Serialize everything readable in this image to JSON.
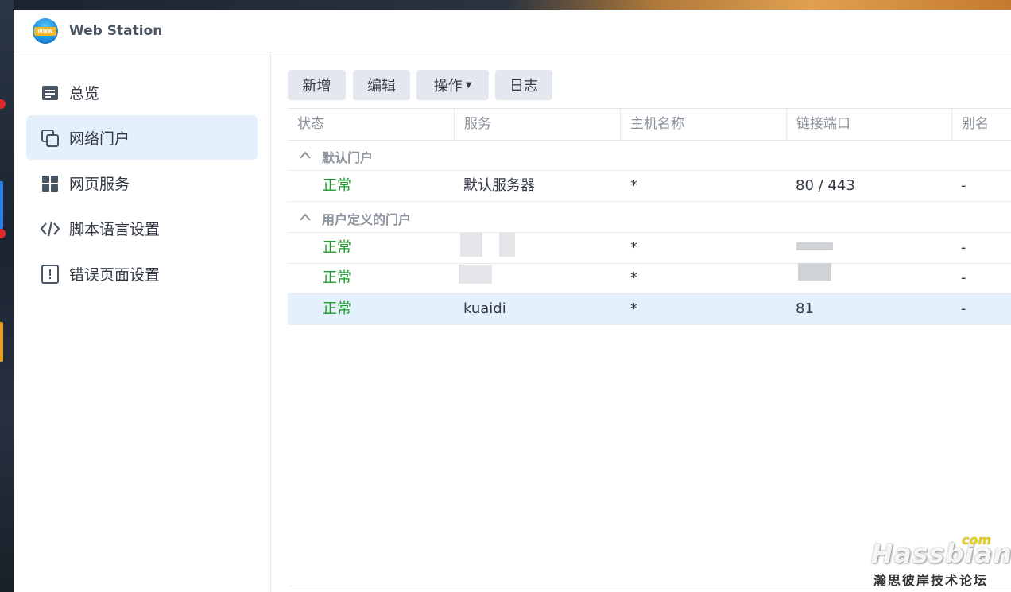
{
  "window": {
    "title": "Web Station",
    "icon_text": "www"
  },
  "sidebar": {
    "items": [
      {
        "label": "总览",
        "icon": "overview-icon",
        "active": false
      },
      {
        "label": "网络门户",
        "icon": "web-portal-icon",
        "active": true
      },
      {
        "label": "网页服务",
        "icon": "web-service-icon",
        "active": false
      },
      {
        "label": "脚本语言设置",
        "icon": "code-icon",
        "active": false
      },
      {
        "label": "错误页面设置",
        "icon": "error-page-icon",
        "active": false
      }
    ]
  },
  "toolbar": {
    "create_label": "新增",
    "edit_label": "编辑",
    "action_label": "操作",
    "log_label": "日志"
  },
  "table": {
    "columns": [
      "状态",
      "服务",
      "主机名称",
      "链接端口",
      "别名"
    ],
    "groups": [
      {
        "label": "默认门户",
        "rows": [
          {
            "status": "正常",
            "service": "默认服务器",
            "host": "*",
            "port": "80 / 443",
            "alias": "-"
          }
        ]
      },
      {
        "label": "用户定义的门户",
        "rows": [
          {
            "status": "正常",
            "service": "",
            "host": "*",
            "port": "",
            "alias": "-"
          },
          {
            "status": "正常",
            "service": "",
            "host": "*",
            "port": "",
            "alias": "-"
          },
          {
            "status": "正常",
            "service": "kuaidi",
            "host": "*",
            "port": "81",
            "alias": "-"
          }
        ]
      }
    ]
  },
  "watermark": {
    "brand": "Hassbian",
    "tld": "com",
    "subtitle": "瀚思彼岸技术论坛"
  },
  "colors": {
    "status_ok": "#1a9c2a",
    "selection": "#e4f0fc",
    "button_bg": "#e3e8ee"
  }
}
